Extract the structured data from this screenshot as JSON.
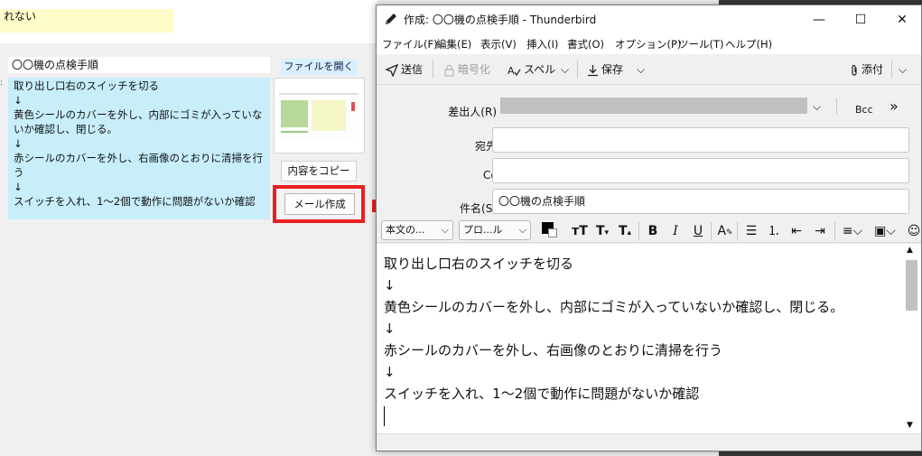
{
  "background_app": {
    "note_text": "れない",
    "title_value": "〇〇機の点検手順",
    "open_file_label": "ファイルを開く",
    "body_text": "取り出し口右のスイッチを切る\n↓\n黄色シールのカバーを外し、内部にゴミが入っていないか確認し、閉じる。\n↓\n赤シールのカバーを外し、右画像のとおりに清掃を行う\n↓\nスイッチを入れ、1～2個で動作に問題がないか確認",
    "copy_label": "内容をコピー",
    "compose_label": "メール作成",
    "highlight_color": "#e8201f"
  },
  "window": {
    "title": "作成: 〇〇機の点検手順 - Thunderbird",
    "minimize": "—",
    "maximize": "☐",
    "close": "✕"
  },
  "menu": [
    {
      "label": "ファイル(F)"
    },
    {
      "label": "編集(E)"
    },
    {
      "label": "表示(V)"
    },
    {
      "label": "挿入(I)"
    },
    {
      "label": "書式(O)"
    },
    {
      "label": "オプション(P)"
    },
    {
      "label": "ツール(T)"
    },
    {
      "label": "ヘルプ(H)"
    }
  ],
  "toolbar": {
    "send": "送信",
    "encrypt": "暗号化",
    "spell": "スペル",
    "save": "保存",
    "attach": "添付"
  },
  "headers": {
    "from_label": "差出人(R)",
    "bcc": "Bcc",
    "more": "»",
    "to_label": "宛先",
    "cc_label": "Cc",
    "subject_label": "件名(S)",
    "subject_value": "〇〇機の点検手順"
  },
  "format_bar": {
    "paragraph": "本文の...",
    "font": "プロ...ル"
  },
  "compose_body": "取り出し口右のスイッチを切る\n↓\n黄色シールのカバーを外し、内部にゴミが入っていないか確認し、閉じる。\n↓\n赤シールのカバーを外し、右画像のとおりに清掃を行う\n↓\nスイッチを入れ、1～2個で動作に問題がないか確認\n"
}
